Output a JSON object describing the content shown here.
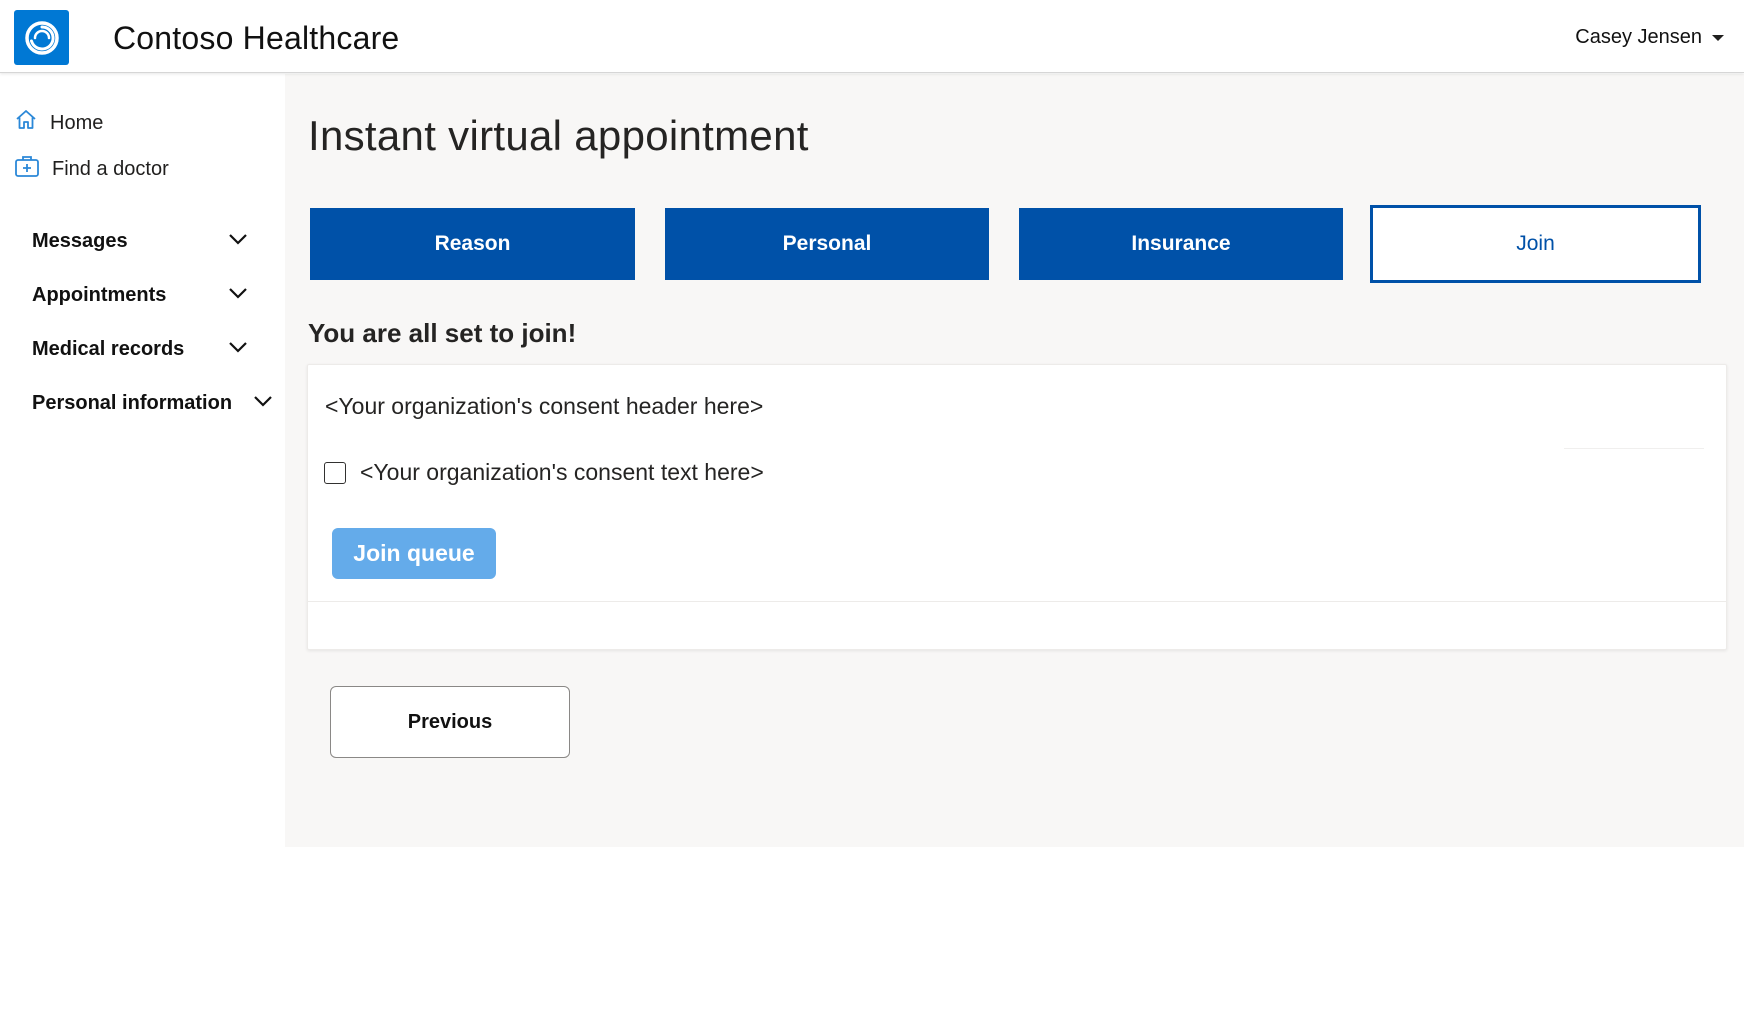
{
  "header": {
    "app_title": "Contoso Healthcare",
    "user_name": "Casey Jensen",
    "logo_icon": "contoso-ring-icon",
    "brand_color": "#0078d4"
  },
  "sidebar": {
    "links": [
      {
        "label": "Home",
        "icon": "home-icon"
      },
      {
        "label": "Find a doctor",
        "icon": "medical-kit-icon"
      }
    ],
    "sections": [
      {
        "label": "Messages"
      },
      {
        "label": "Appointments"
      },
      {
        "label": "Medical records"
      },
      {
        "label": "Personal information"
      }
    ],
    "icon_color": "#2b88d8"
  },
  "main": {
    "page_title": "Instant virtual appointment",
    "steps": [
      {
        "label": "Reason",
        "state": "completed"
      },
      {
        "label": "Personal",
        "state": "completed"
      },
      {
        "label": "Insurance",
        "state": "completed"
      },
      {
        "label": "Join",
        "state": "current"
      }
    ],
    "step_color": "#0051a8",
    "subtitle": "You are all set to join!",
    "consent": {
      "header": "<Your organization's consent header here>",
      "text": "<Your organization's consent text here>",
      "checked": false
    },
    "join_button": {
      "label": "Join queue",
      "color": "#64abea",
      "disabled": true
    },
    "previous_button": {
      "label": "Previous"
    }
  }
}
